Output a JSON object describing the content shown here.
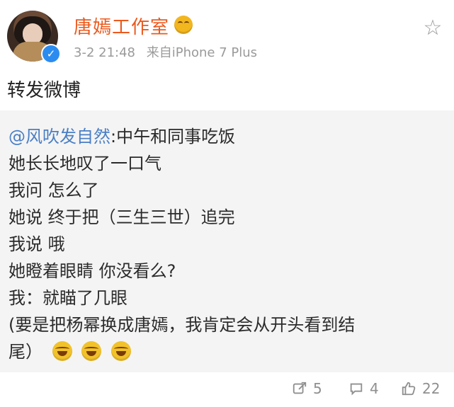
{
  "header": {
    "username": "唐嫣工作室",
    "time": "3-2 21:48",
    "source": "来自iPhone 7 Plus"
  },
  "post": {
    "title": "转发微博"
  },
  "repost": {
    "mention": "@风吹发自然",
    "first_line_rest": ":中午和同事吃饭",
    "lines": [
      "她长长地叹了一口气",
      "我问 怎么了",
      "她说 终于把（三生三世）追完",
      "我说 哦",
      "她瞪着眼睛 你没看么?",
      "我：就瞄了几眼",
      "(要是把杨幂换成唐嫣，我肯定会从开头看到结",
      "尾）"
    ]
  },
  "actions": {
    "repost_count": "5",
    "comment_count": "4",
    "like_count": "22"
  },
  "icons": {
    "star": "star-outline-icon",
    "repost": "share-icon",
    "comment": "comment-icon",
    "like": "thumbs-up-icon"
  },
  "colors": {
    "username": "#ea5a1e",
    "mention": "#4a7fc5",
    "verified": "#2b8cf0",
    "repost_bg": "#f4f4f4"
  }
}
